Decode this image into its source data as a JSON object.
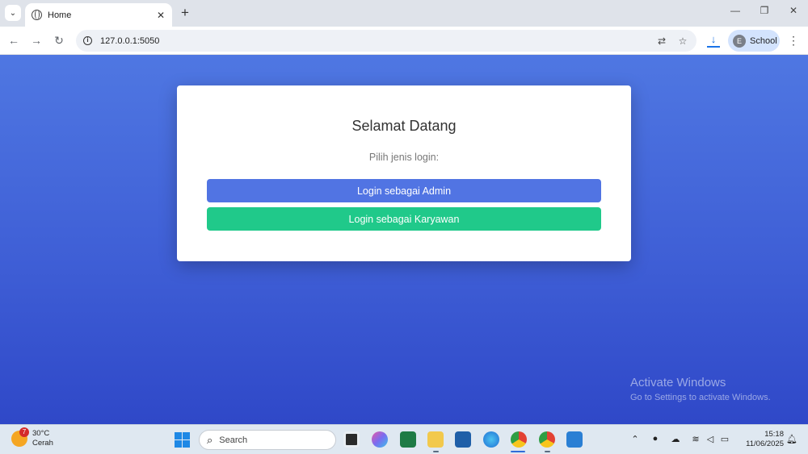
{
  "browser": {
    "tab_title": "Home",
    "url": "127.0.0.1:5050",
    "profile_initial": "E",
    "profile_label": "School"
  },
  "page": {
    "title": "Selamat Datang",
    "subtitle": "Pilih jenis login:",
    "admin_button": "Login sebagai Admin",
    "karyawan_button": "Login sebagai Karyawan",
    "colors": {
      "admin": "#5174e3",
      "karyawan": "#20c98a",
      "background": "#3f5fd6"
    }
  },
  "watermark": {
    "title": "Activate Windows",
    "subtitle": "Go to Settings to activate Windows."
  },
  "taskbar": {
    "weather_temp": "30°C",
    "weather_desc": "Cerah",
    "weather_badge": "7",
    "search_label": "Search",
    "time": "15:18",
    "date": "11/06/2025"
  }
}
